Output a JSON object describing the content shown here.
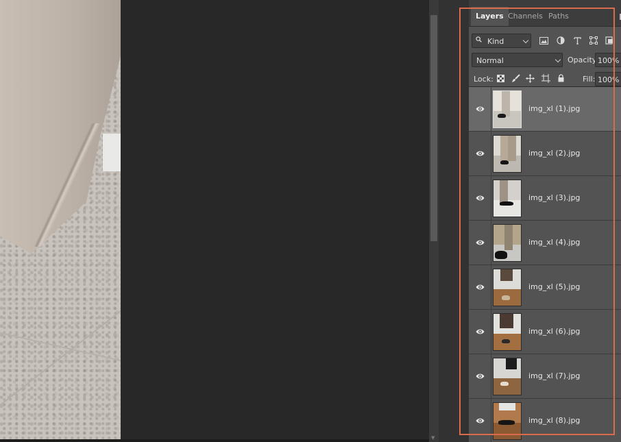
{
  "panel": {
    "tabs": [
      {
        "label": "Layers",
        "active": true
      },
      {
        "label": "Channels",
        "active": false
      },
      {
        "label": "Paths",
        "active": false
      }
    ],
    "filter": {
      "kind_label": "Kind",
      "icons": [
        "image-filter-icon",
        "adjustment-filter-icon",
        "type-filter-icon",
        "shape-filter-icon",
        "smart-object-filter-icon"
      ]
    },
    "blend_mode": "Normal",
    "opacity_label": "Opacity:",
    "opacity_value": "100%",
    "lock_label": "Lock:",
    "lock_icons": [
      "lock-transparent-pixels-icon",
      "lock-image-pixels-icon",
      "lock-position-icon",
      "lock-artboard-icon",
      "lock-all-icon"
    ],
    "fill_label": "Fill:",
    "fill_value": "100%"
  },
  "layers": [
    {
      "name": "img_xl (1).jpg",
      "visible": true,
      "selected": true
    },
    {
      "name": "img_xl (2).jpg",
      "visible": true,
      "selected": false
    },
    {
      "name": "img_xl (3).jpg",
      "visible": true,
      "selected": false
    },
    {
      "name": "img_xl (4).jpg",
      "visible": true,
      "selected": false
    },
    {
      "name": "img_xl (5).jpg",
      "visible": true,
      "selected": false
    },
    {
      "name": "img_xl (6).jpg",
      "visible": true,
      "selected": false
    },
    {
      "name": "img_xl (7).jpg",
      "visible": true,
      "selected": false
    },
    {
      "name": "img_xl (8).jpg",
      "visible": true,
      "selected": false
    }
  ],
  "colors": {
    "highlight": "#dc6b4b",
    "panel_bg": "#535353",
    "selected_row": "#696969",
    "workspace_bg": "#282828"
  }
}
